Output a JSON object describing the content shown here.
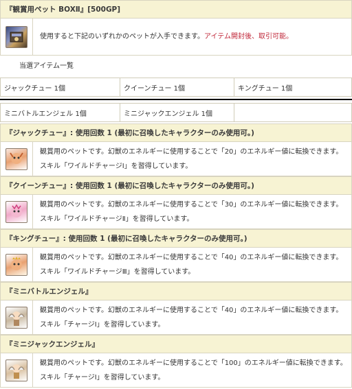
{
  "box": {
    "title": "『観賞用ペット BOXⅡ』[500GP]",
    "desc_main": "使用すると下記のいずれかのペットが入手できます。",
    "desc_red": "アイテム開封後、取引可能。",
    "icon": "box-item-icon"
  },
  "list_heading": "当選アイテム一覧",
  "items_row1": [
    "ジャックチュー 1個",
    "クイーンチュー 1個",
    "キングチュー 1個"
  ],
  "items_row2": [
    "ミニバトルエンジェル 1個",
    "ミニジャックエンジェル 1個",
    ""
  ],
  "pets": [
    {
      "header": "『ジャックチュー』: 使用回数 1 (最初に召喚したキャラクターのみ使用可。)",
      "line1": "観賞用のペットです。幻獣のエネルギーに使用することで「20」のエネルギー値に転換できます。",
      "line2": "スキル「ワイルドチャージⅠ」を習得しています。",
      "icon": "jack-chu-pet-icon"
    },
    {
      "header": "『クイーンチュー』: 使用回数 1 (最初に召喚したキャラクターのみ使用可。)",
      "line1": "観賞用のペットです。幻獣のエネルギーに使用することで「30」のエネルギー値に転換できます。",
      "line2": "スキル「ワイルドチャージⅡ」を習得しています。",
      "icon": "queen-chu-pet-icon"
    },
    {
      "header": "『キングチュー』: 使用回数 1 (最初に召喚したキャラクターのみ使用可。)",
      "line1": "観賞用のペットです。幻獣のエネルギーに使用することで「40」のエネルギー値に転換できます。",
      "line2": "スキル「ワイルドチャージⅢ」を習得しています。",
      "icon": "king-chu-pet-icon"
    },
    {
      "header": "『ミニバトルエンジェル』",
      "line1": "観賞用のペットです。幻獣のエネルギーに使用することで「40」のエネルギー値に転換できます。",
      "line2": "スキル「チャージⅠ」を習得しています。",
      "icon": "mini-battle-angel-pet-icon"
    },
    {
      "header": "『ミニジャックエンジェル』",
      "line1": "観賞用のペットです。幻獣のエネルギーに使用することで「100」のエネルギー値に転換できます。",
      "line2": "スキル「チャージⅠ」を習得しています。",
      "icon": "mini-jack-angel-pet-icon"
    }
  ],
  "colors": {
    "header_bg": "#f7f3d3",
    "border": "#d8d4c0",
    "accent_red": "#c0283a"
  }
}
